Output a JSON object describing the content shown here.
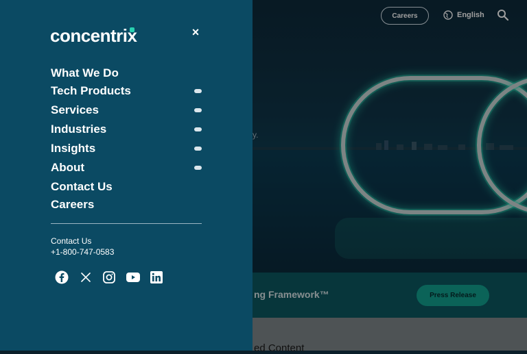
{
  "header": {
    "careers_label": "Careers",
    "language_label": "English"
  },
  "hero": {
    "text_fragment": "y."
  },
  "press": {
    "title_fragment": "ng Framework™",
    "button_label": "Press Release"
  },
  "below": {
    "title_fragment": "ed Content"
  },
  "menu": {
    "logo_text": "concentrix",
    "close_symbol": "×",
    "items": [
      {
        "label": "What We Do",
        "expandable": false
      },
      {
        "label": "Tech Products",
        "expandable": true
      },
      {
        "label": "Services",
        "expandable": true
      },
      {
        "label": "Industries",
        "expandable": true
      },
      {
        "label": "Insights",
        "expandable": true
      },
      {
        "label": "About",
        "expandable": true
      },
      {
        "label": "Contact Us",
        "expandable": false
      },
      {
        "label": "Careers",
        "expandable": false
      }
    ],
    "contact_label": "Contact Us",
    "contact_phone": "+1-800-747-0583",
    "social": [
      "facebook-icon",
      "x-icon",
      "instagram-icon",
      "youtube-icon",
      "linkedin-icon"
    ]
  },
  "colors": {
    "menu_bg": "#0b4a63",
    "accent": "#12a08f",
    "logo_accent": "#28d1b0",
    "glow": "#2ee6c0"
  }
}
